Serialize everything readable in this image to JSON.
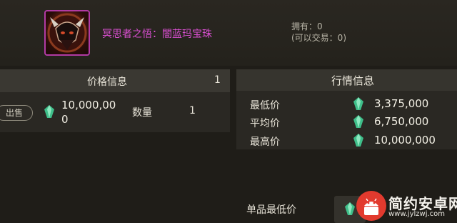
{
  "item": {
    "name": "冥思者之悟：闇蓝玛宝珠",
    "owned": "拥有：0",
    "tradable": "(可以交易：0)",
    "icon": "demon-helm-icon",
    "frame_color": "#b23aa3"
  },
  "price_info": {
    "title": "价格信息",
    "count": "1",
    "sell_label": "出售",
    "price": "10,000,000",
    "quantity_label": "数量",
    "quantity": "1",
    "currency_icon": "gem-icon"
  },
  "market_info": {
    "title": "行情信息",
    "rows": [
      {
        "label": "最低价",
        "value": "3,375,000"
      },
      {
        "label": "平均价",
        "value": "6,750,000"
      },
      {
        "label": "最高价",
        "value": "10,000,000"
      }
    ],
    "unit_low_label": "单品最低价"
  },
  "watermark": {
    "main": "简约安卓网",
    "sub": "www.jylzwj.com",
    "logo": "android-robot-logo"
  },
  "colors": {
    "item_name": "#d84fd0",
    "gem": "#3fbf8a",
    "background": "#1f1d18"
  }
}
